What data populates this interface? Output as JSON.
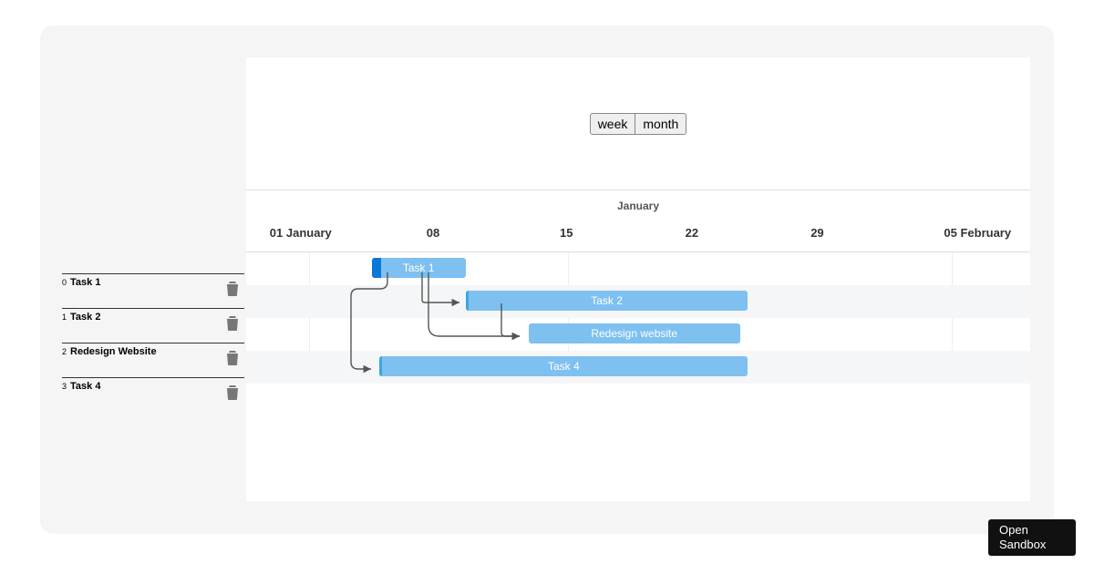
{
  "controls": {
    "view_week": "week",
    "view_month": "month"
  },
  "timeline": {
    "month_label": "January",
    "ticks": [
      {
        "label": "01 January",
        "pct": 3
      },
      {
        "label": "08",
        "pct": 23
      },
      {
        "label": "15",
        "pct": 40
      },
      {
        "label": "22",
        "pct": 56
      },
      {
        "label": "29",
        "pct": 72
      },
      {
        "label": "05 February",
        "pct": 89
      }
    ],
    "gridlines_pct": [
      8,
      41,
      90
    ]
  },
  "sidebar": {
    "tasks": [
      {
        "idx": "0",
        "name": "Task 1"
      },
      {
        "idx": "1",
        "name": "Task 2"
      },
      {
        "idx": "2",
        "name": "Redesign Website"
      },
      {
        "idx": "3",
        "name": "Task 4"
      }
    ]
  },
  "bars": [
    {
      "row": 0,
      "label": "Task 1",
      "left_pct": 16,
      "width_pct": 12,
      "progress_pct": 10
    },
    {
      "row": 1,
      "label": "Task 2",
      "left_pct": 28,
      "width_pct": 36,
      "progress_pct": 1
    },
    {
      "row": 2,
      "label": "Redesign website",
      "left_pct": 36,
      "width_pct": 27,
      "progress_pct": 0
    },
    {
      "row": 3,
      "label": "Task 4",
      "left_pct": 17,
      "width_pct": 47,
      "progress_pct": 0.7
    }
  ],
  "sandbox": {
    "line1": "Open",
    "line2": "Sandbox"
  }
}
